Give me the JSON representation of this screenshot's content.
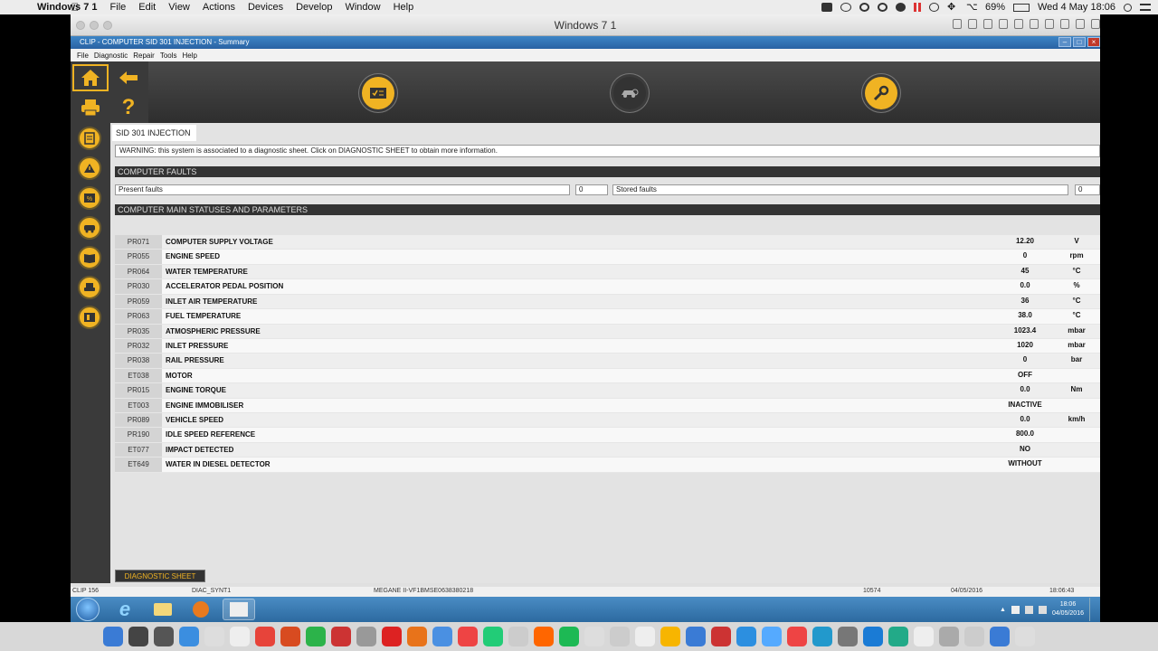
{
  "mac_menubar": {
    "app_name": "Windows 7 1",
    "menus": [
      "File",
      "Edit",
      "View",
      "Actions",
      "Devices",
      "Develop",
      "Window",
      "Help"
    ],
    "battery": "69%",
    "datetime": "Wed 4 May  18:06"
  },
  "vm_window": {
    "title": "Windows 7 1"
  },
  "clip": {
    "title": "CLIP - COMPUTER SID 301 INJECTION - Summary",
    "menus": [
      "File",
      "Diagnostic",
      "Repair",
      "Tools",
      "Help"
    ],
    "system_tab": "SID 301 INJECTION",
    "warning": "WARNING: this system is associated to a diagnostic sheet. Click on DIAGNOSTIC SHEET to obtain more information.",
    "faults_header": "COMPUTER FAULTS",
    "present_faults_label": "Present faults",
    "present_faults_count": "0",
    "stored_faults_label": "Stored faults",
    "stored_faults_count": "0",
    "params_header": "COMPUTER MAIN STATUSES AND PARAMETERS",
    "params": [
      {
        "code": "PR071",
        "name": "COMPUTER SUPPLY VOLTAGE",
        "value": "12.20",
        "unit": "V"
      },
      {
        "code": "PR055",
        "name": "ENGINE SPEED",
        "value": "0",
        "unit": "rpm"
      },
      {
        "code": "PR064",
        "name": "WATER TEMPERATURE",
        "value": "45",
        "unit": "°C"
      },
      {
        "code": "PR030",
        "name": "ACCELERATOR PEDAL POSITION",
        "value": "0.0",
        "unit": "%"
      },
      {
        "code": "PR059",
        "name": "INLET AIR TEMPERATURE",
        "value": "36",
        "unit": "°C"
      },
      {
        "code": "PR063",
        "name": "FUEL TEMPERATURE",
        "value": "38.0",
        "unit": "°C"
      },
      {
        "code": "PR035",
        "name": "ATMOSPHERIC PRESSURE",
        "value": "1023.4",
        "unit": "mbar"
      },
      {
        "code": "PR032",
        "name": "INLET PRESSURE",
        "value": "1020",
        "unit": "mbar"
      },
      {
        "code": "PR038",
        "name": "RAIL PRESSURE",
        "value": "0",
        "unit": "bar"
      },
      {
        "code": "ET038",
        "name": "MOTOR",
        "value": "OFF",
        "unit": ""
      },
      {
        "code": "PR015",
        "name": "ENGINE TORQUE",
        "value": "0.0",
        "unit": "Nm"
      },
      {
        "code": "ET003",
        "name": "ENGINE IMMOBILISER",
        "value": "INACTIVE",
        "unit": ""
      },
      {
        "code": "PR089",
        "name": "VEHICLE SPEED",
        "value": "0.0",
        "unit": "km/h"
      },
      {
        "code": "PR190",
        "name": "IDLE SPEED REFERENCE",
        "value": "800.0",
        "unit": ""
      },
      {
        "code": "ET077",
        "name": "IMPACT DETECTED",
        "value": "NO",
        "unit": ""
      },
      {
        "code": "ET649",
        "name": "WATER IN DIESEL DETECTOR",
        "value": "WITHOUT",
        "unit": ""
      }
    ],
    "diagnostic_sheet_button": "DIAGNOSTIC SHEET",
    "status": {
      "version": "CLIP 156",
      "diac": "DIAC_SYNT1",
      "vehicle": "MEGANE II-VF1BMSE0638380218",
      "code": "10574",
      "date": "04/05/2016",
      "time": "18:06:43"
    }
  },
  "taskbar": {
    "clock_time": "18:06",
    "clock_date": "04/05/2016"
  },
  "colors": {
    "accent": "#f0b323",
    "dark": "#333333"
  }
}
